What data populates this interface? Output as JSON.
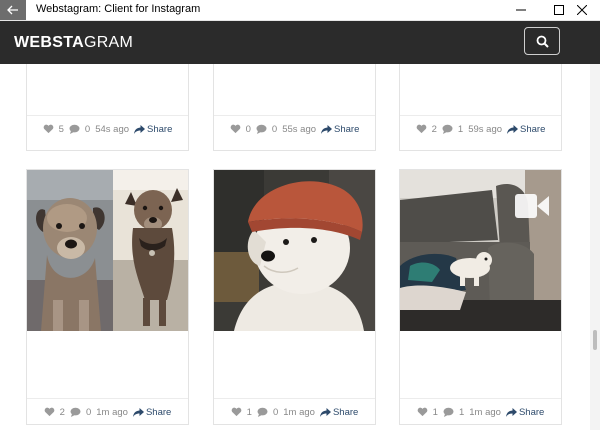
{
  "window": {
    "title": "Webstagram: Client for Instagram",
    "back_icon": "back-arrow-icon",
    "minimize_icon": "minimize-icon",
    "maximize_icon": "maximize-icon",
    "close_icon": "close-icon"
  },
  "header": {
    "logo_bold": "WEBSTA",
    "logo_regular": "GRAM",
    "search_icon": "search-icon"
  },
  "posts_top": [
    {
      "likes": "5",
      "comments": "0",
      "time": "54s ago",
      "share": "Share"
    },
    {
      "likes": "0",
      "comments": "0",
      "time": "55s ago",
      "share": "Share"
    },
    {
      "likes": "2",
      "comments": "1",
      "time": "59s ago",
      "share": "Share"
    }
  ],
  "posts_bottom": [
    {
      "likes": "2",
      "comments": "0",
      "time": "1m ago",
      "share": "Share",
      "image": "two terrier dogs photo collage"
    },
    {
      "likes": "1",
      "comments": "0",
      "time": "1m ago",
      "share": "Share",
      "image": "white dog wearing red knit hat"
    },
    {
      "likes": "1",
      "comments": "1",
      "time": "1m ago",
      "share": "Share",
      "image": "small white dog on grey leather sofa",
      "video_icon": "video-camera-icon"
    }
  ],
  "colors": {
    "appbar": "#2b2b2b",
    "share_link": "#2d4a6b",
    "meta_text": "#888888"
  }
}
